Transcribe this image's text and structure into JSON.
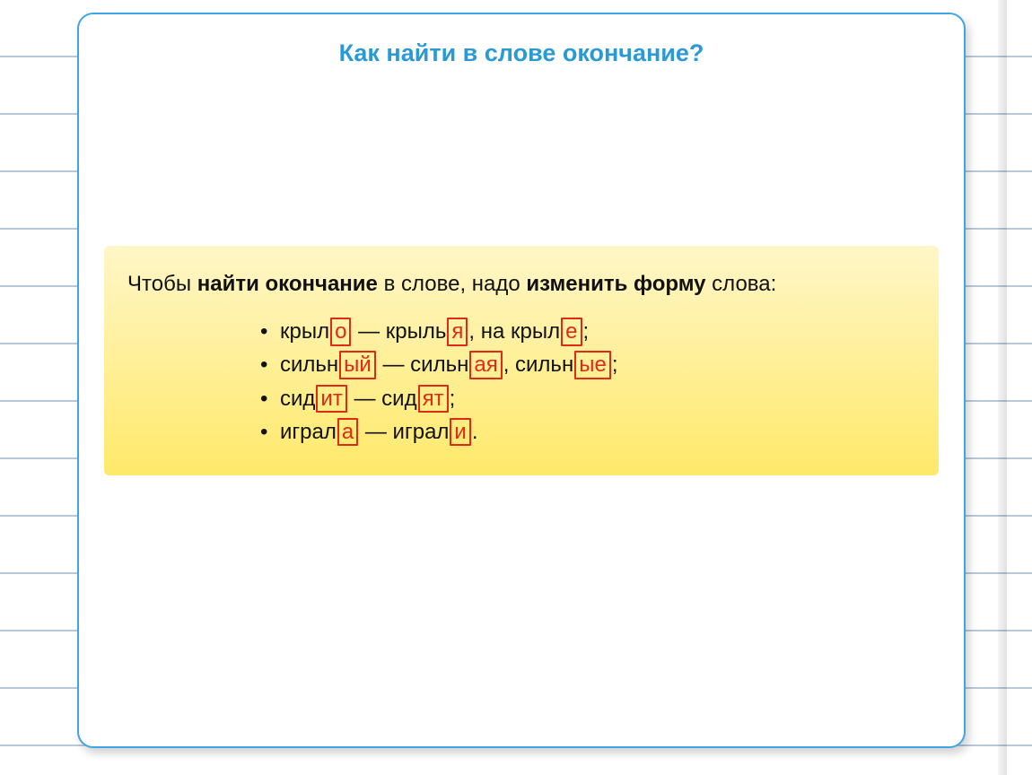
{
  "title": "Как найти в слове окончание?",
  "intro": {
    "p1": "Чтобы ",
    "b1": "найти окончание",
    "p2": " в слове, надо ",
    "b2": "изменить форму",
    "p3": " слова:"
  },
  "lines": [
    {
      "parts": [
        {
          "t": "крыл"
        },
        {
          "t": "о",
          "e": true
        },
        {
          "t": " — крыль"
        },
        {
          "t": "я",
          "e": true
        },
        {
          "t": ", на крыл"
        },
        {
          "t": "е",
          "e": true
        },
        {
          "t": ";"
        }
      ]
    },
    {
      "parts": [
        {
          "t": "сильн"
        },
        {
          "t": "ый",
          "e": true
        },
        {
          "t": " — сильн"
        },
        {
          "t": "ая",
          "e": true
        },
        {
          "t": ", сильн"
        },
        {
          "t": "ые",
          "e": true
        },
        {
          "t": ";"
        }
      ]
    },
    {
      "parts": [
        {
          "t": "сид"
        },
        {
          "t": "ит",
          "e": true
        },
        {
          "t": " — сид"
        },
        {
          "t": "ят",
          "e": true
        },
        {
          "t": ";"
        }
      ]
    },
    {
      "parts": [
        {
          "t": "играл"
        },
        {
          "t": "а",
          "e": true
        },
        {
          "t": " — играл"
        },
        {
          "t": "и",
          "e": true
        },
        {
          "t": "."
        }
      ]
    }
  ]
}
